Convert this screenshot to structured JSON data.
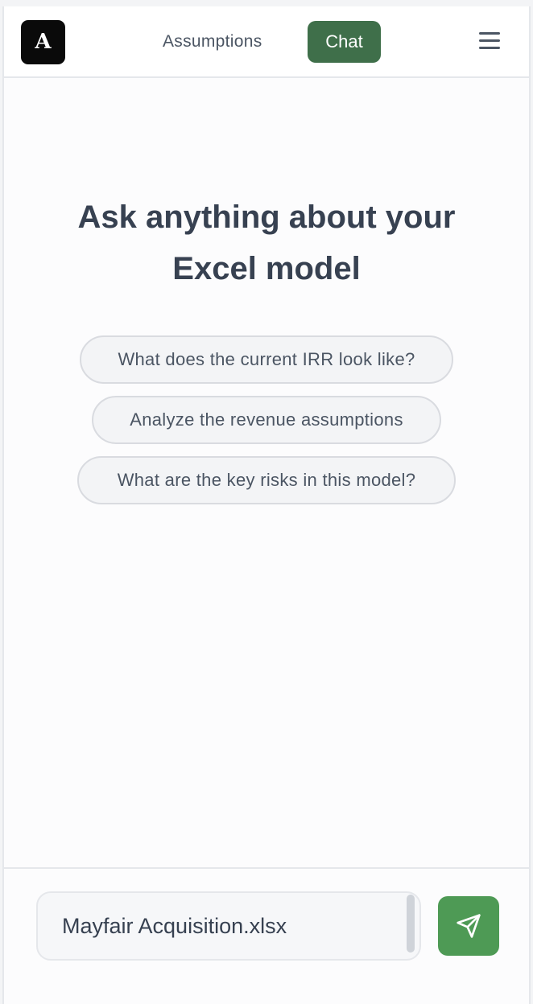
{
  "header": {
    "logo_letter": "A",
    "nav_assumptions": "Assumptions",
    "tab_chat": "Chat",
    "menu_icon": "hamburger-menu-icon",
    "accent_color": "#3f6f4a"
  },
  "main": {
    "heading_line1": "Ask anything about your",
    "heading_line2": "Excel model",
    "suggestions": [
      "What does the current IRR look like?",
      "Analyze the revenue assumptions",
      "What are the key risks in this model?"
    ]
  },
  "composer": {
    "input_value": "Mayfair Acquisition.xlsx",
    "send_icon": "send-paper-plane-icon",
    "send_color": "#4e9a55"
  }
}
